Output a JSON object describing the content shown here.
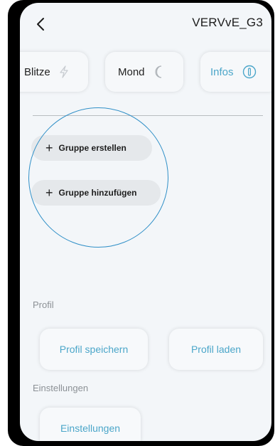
{
  "header": {
    "title": "VERVvE_G3",
    "back_icon": "chevron-left-icon"
  },
  "tabs": [
    {
      "label": "Blitze",
      "icon": "lightning-icon"
    },
    {
      "label": "Mond",
      "icon": "moon-icon"
    },
    {
      "label": "Infos",
      "icon": "info-icon",
      "active": true
    }
  ],
  "groups": {
    "create_label": "Gruppe erstellen",
    "add_label": "Gruppe hinzufügen"
  },
  "profile_section": {
    "label": "Profil",
    "save_label": "Profil speichern",
    "load_label": "Profil laden"
  },
  "settings_section": {
    "label": "Einstellungen",
    "button_label": "Einstellungen"
  },
  "colors": {
    "accent": "#4ba6c9",
    "highlight_circle": "#2f8fc7",
    "background": "#f3f6f9"
  }
}
